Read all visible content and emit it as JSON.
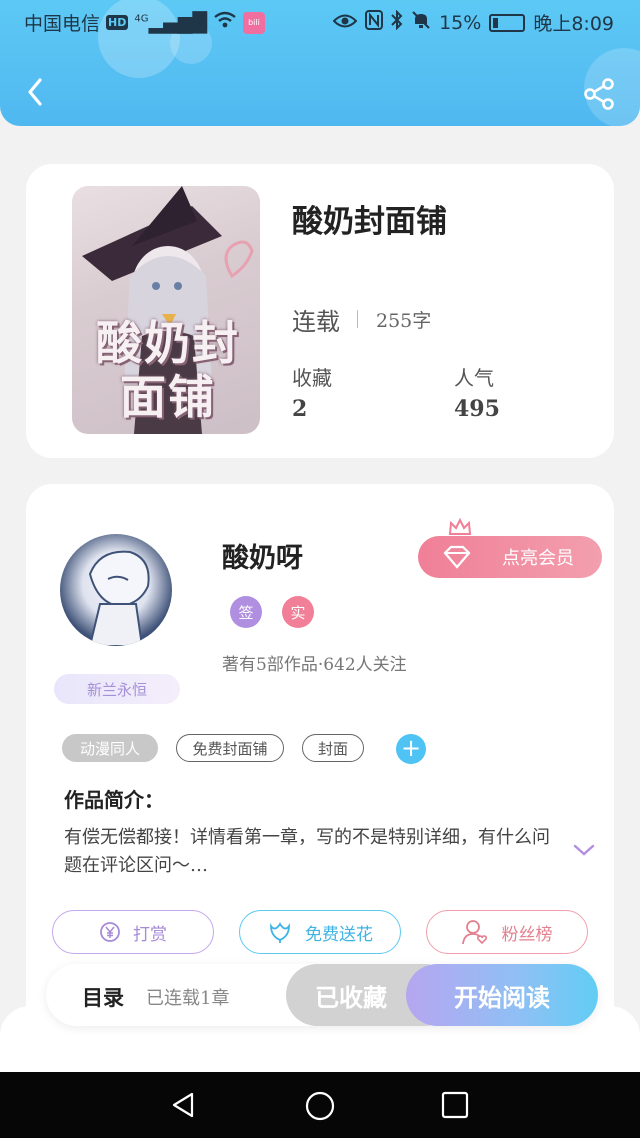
{
  "status_bar": {
    "carrier": "中国电信",
    "hd": "HD",
    "network": "4G",
    "battery": "15%",
    "time": "晚上8:09"
  },
  "header": {
    "back_icon": "chevron-left-icon",
    "share_icon": "share-icon"
  },
  "book": {
    "cover_text": "酸奶封面铺",
    "title": "酸奶封面铺",
    "status": "连载",
    "word_count": "255字",
    "favorites_label": "收藏",
    "favorites_value": "2",
    "popularity_label": "人气",
    "popularity_value": "495"
  },
  "author": {
    "name": "酸奶呀",
    "vip_button": "点亮会员",
    "badge_signed": "签",
    "badge_verified": "实",
    "stats": "著有5部作品·642人关注",
    "title_badge": "新兰永恒"
  },
  "tags": [
    "动漫同人",
    "免费封面铺",
    "封面"
  ],
  "intro": {
    "heading": "作品简介：",
    "text": "有偿无偿都接！详情看第一章，写的不是特别详细，有什么问题在评论区问～…"
  },
  "actions": {
    "reward": "打赏",
    "flower": "免费送花",
    "fans": "粉丝榜"
  },
  "bottom": {
    "toc": "目录",
    "chapters": "已连载1章",
    "collected": "已收藏",
    "read": "开始阅读"
  },
  "colors": {
    "header_blue": "#5cc9f5",
    "accent_pink": "#f07f97",
    "accent_purple": "#b18fe0",
    "accent_cyan": "#4fc3f3"
  }
}
